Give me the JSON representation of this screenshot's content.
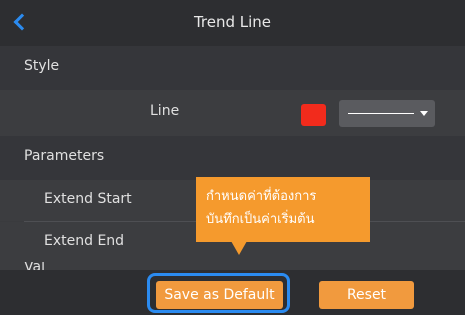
{
  "header": {
    "back": "back",
    "title": "Trend Line"
  },
  "sections": {
    "style": "Style",
    "parameters": "Parameters",
    "next_partial": "Val"
  },
  "style_row": {
    "label": "Line",
    "color": "#f22b1c",
    "line_style": "solid"
  },
  "parameter_rows": {
    "extend_start": "Extend Start",
    "extend_end": "Extend End"
  },
  "tooltip": {
    "line1": "กำหนดค่าที่ต้องการ",
    "line2": "บันทึกเป็นค่าเริ่มต้น"
  },
  "buttons": {
    "save_default": "Save as Default",
    "reset": "Reset"
  },
  "colors": {
    "accent": "#2b8bf0",
    "button": "#f19a3e",
    "tooltip": "#f59a2d"
  }
}
